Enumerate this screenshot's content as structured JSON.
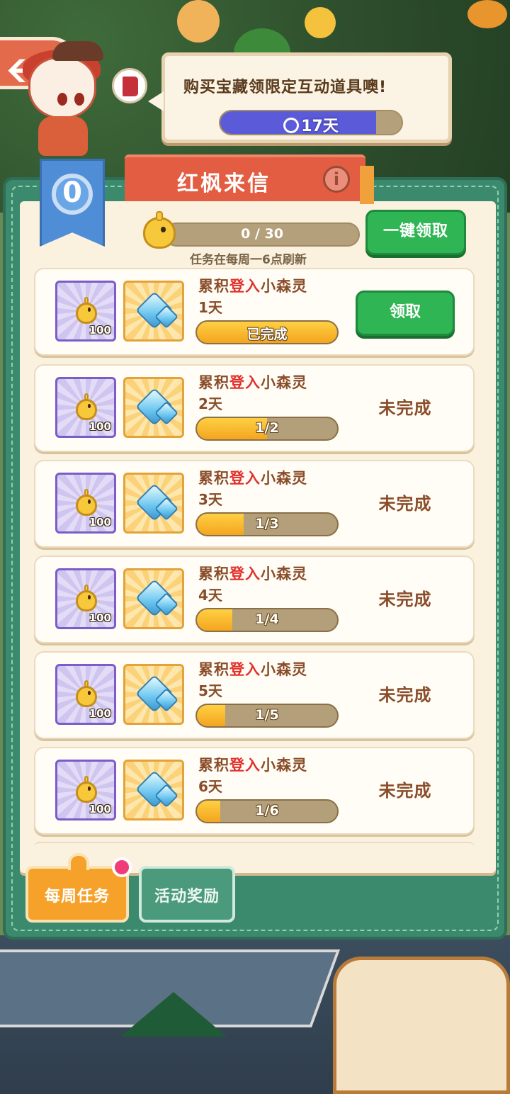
{
  "header": {
    "back_icon": "back-arrow-icon",
    "book_icon": "book-icon",
    "speech": "购买宝藏领限定互动道具噢!",
    "timer_label": "17天",
    "timer_fraction": 0.86
  },
  "panel": {
    "title": "红枫来信",
    "info_glyph": "i",
    "level": "0",
    "total_progress_label": "0 / 30",
    "refresh_note": "任务在每周一6点刷新",
    "claim_all_label": "一键领取"
  },
  "tasks": [
    {
      "prefix": "累积",
      "highlight": "登入",
      "suffix": "小森灵",
      "days": "1天",
      "reward_qty": "100",
      "progress_label": "已完成",
      "progress": 1.0,
      "action": "领取"
    },
    {
      "prefix": "累积",
      "highlight": "登入",
      "suffix": "小森灵",
      "days": "2天",
      "reward_qty": "100",
      "progress_label": "1/2",
      "progress": 0.5,
      "action": "未完成"
    },
    {
      "prefix": "累积",
      "highlight": "登入",
      "suffix": "小森灵",
      "days": "3天",
      "reward_qty": "100",
      "progress_label": "1/3",
      "progress": 0.333,
      "action": "未完成"
    },
    {
      "prefix": "累积",
      "highlight": "登入",
      "suffix": "小森灵",
      "days": "4天",
      "reward_qty": "100",
      "progress_label": "1/4",
      "progress": 0.25,
      "action": "未完成"
    },
    {
      "prefix": "累积",
      "highlight": "登入",
      "suffix": "小森灵",
      "days": "5天",
      "reward_qty": "100",
      "progress_label": "1/5",
      "progress": 0.2,
      "action": "未完成"
    },
    {
      "prefix": "累积",
      "highlight": "登入",
      "suffix": "小森灵",
      "days": "6天",
      "reward_qty": "100",
      "progress_label": "1/6",
      "progress": 0.1667,
      "action": "未完成"
    }
  ],
  "tabs": {
    "weekly": "每周任务",
    "rewards": "活动奖励"
  },
  "colors": {
    "accent_green": "#2fb554",
    "highlight_red": "#e2302a",
    "timer_purple": "#5b5ad9"
  }
}
